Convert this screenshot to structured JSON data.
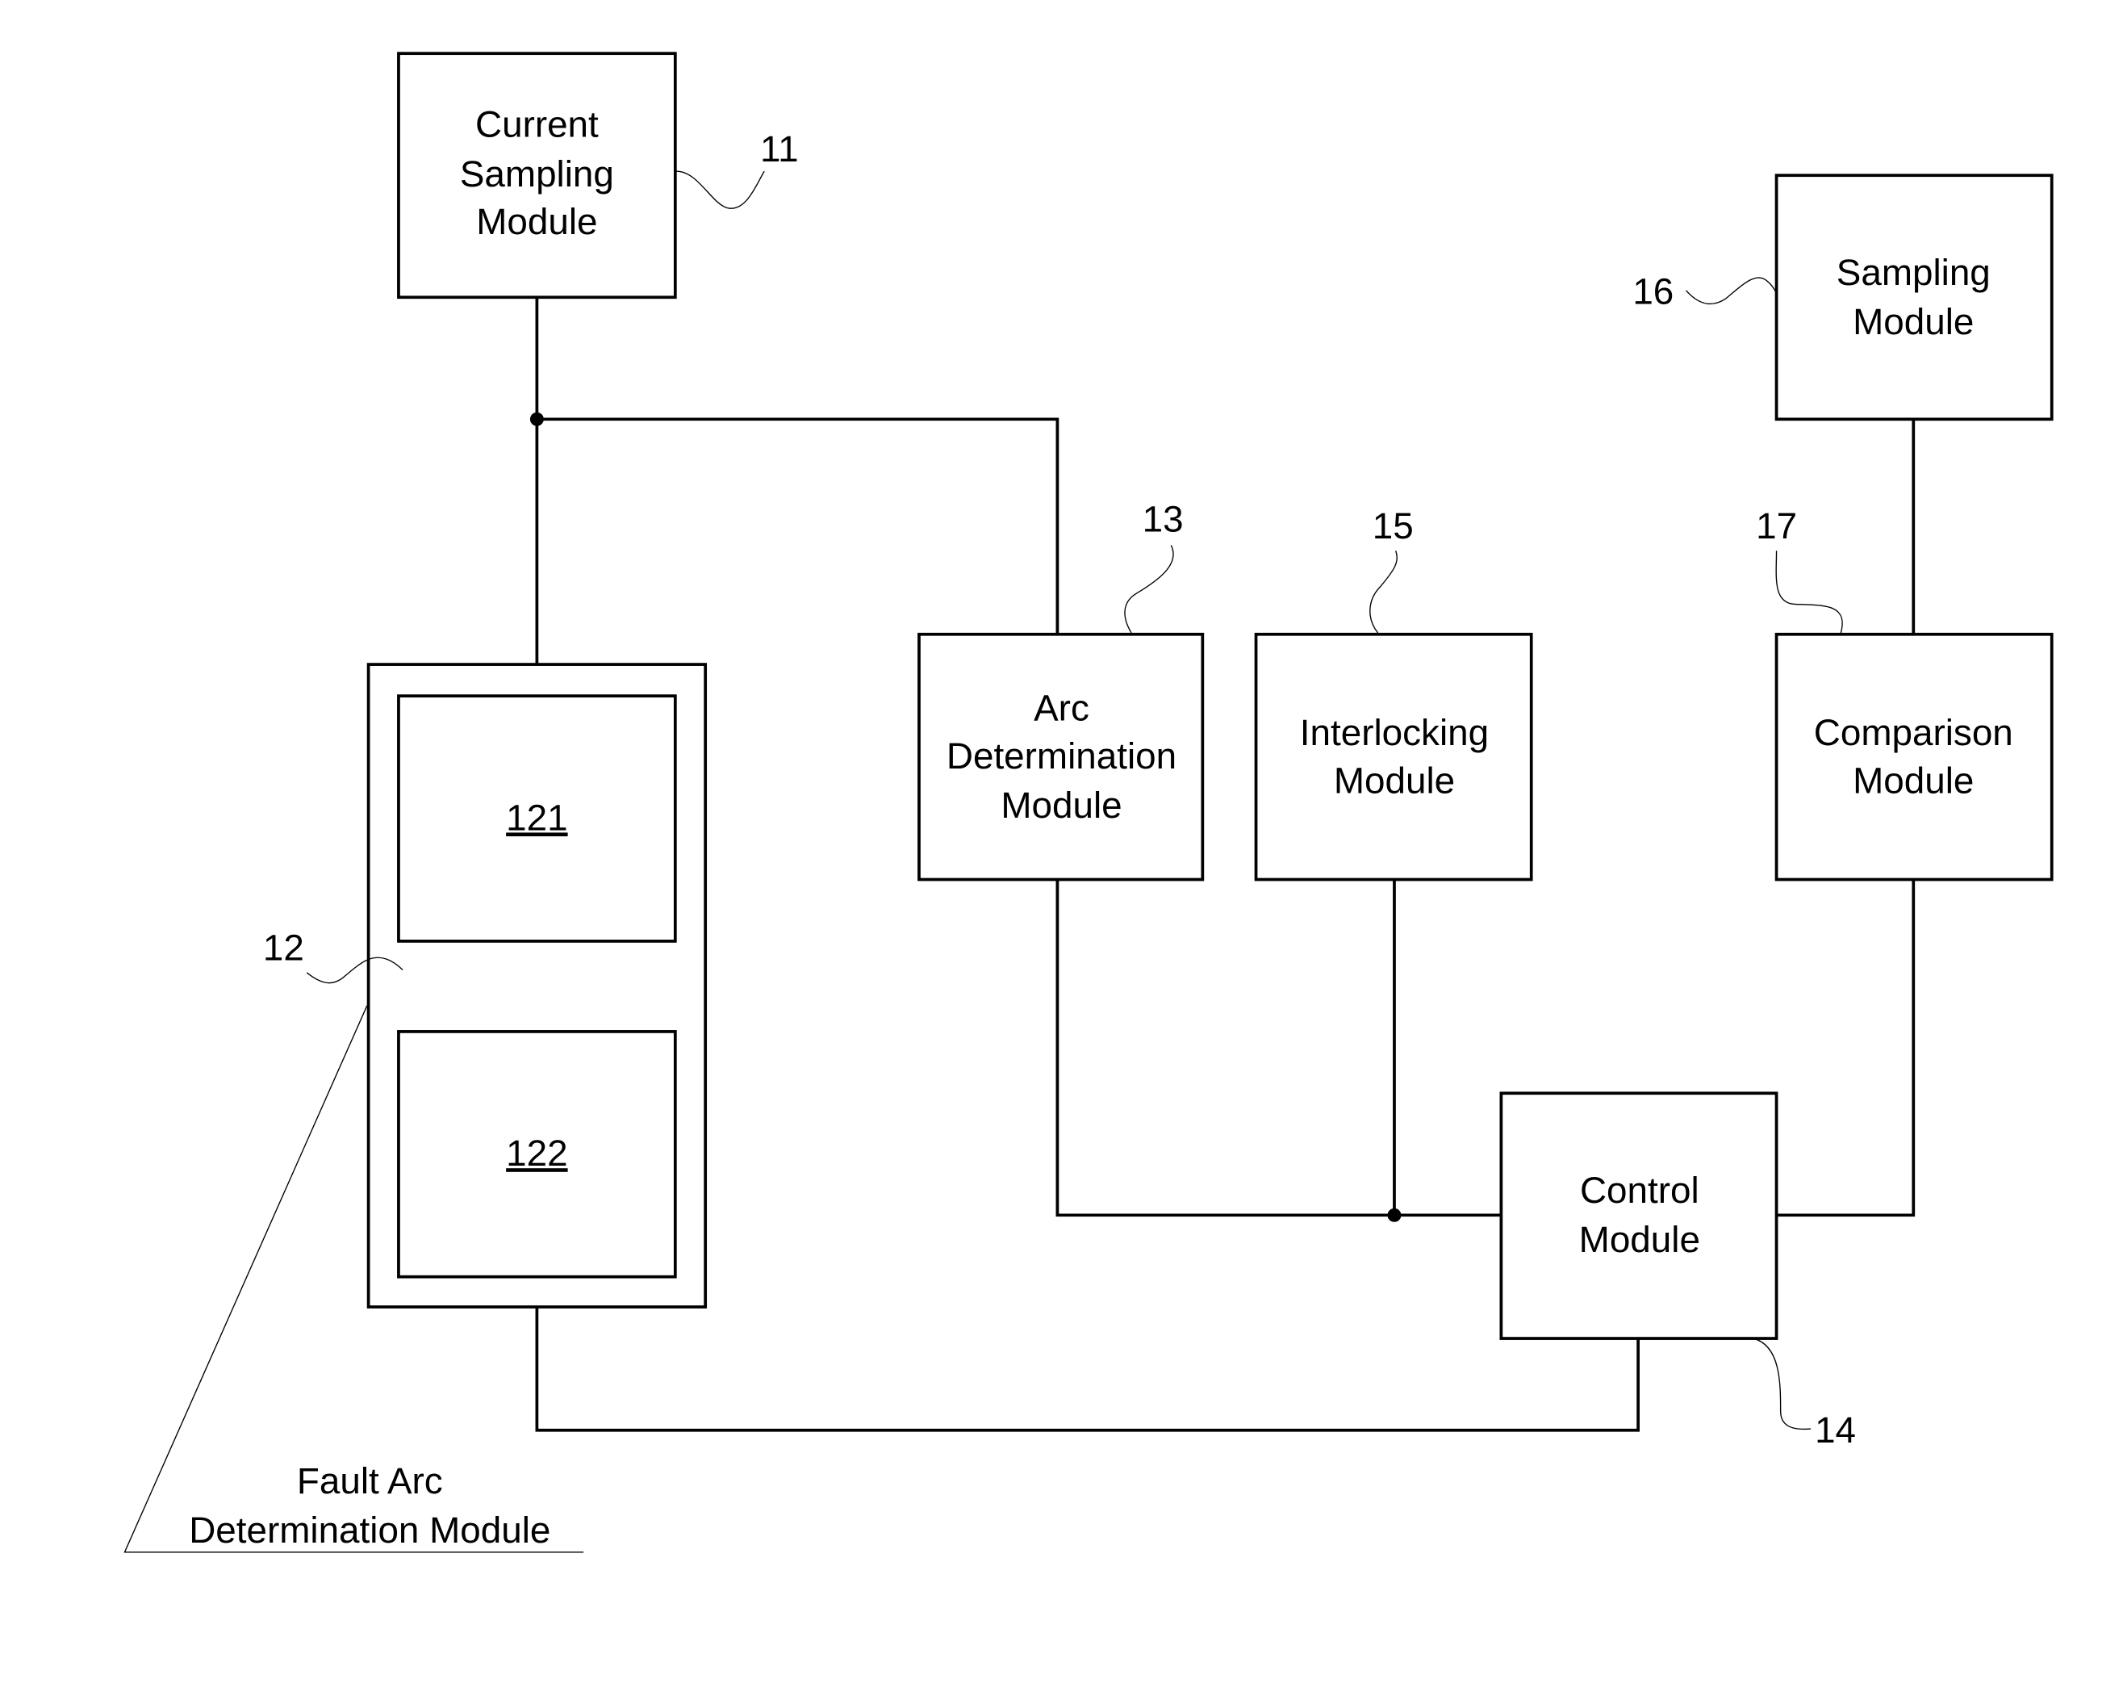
{
  "diagram": {
    "type": "block-diagram",
    "colors": {
      "line": "#000000",
      "background": "#ffffff"
    },
    "modules": {
      "current_sampling": {
        "ref": "11",
        "lines": [
          "Current",
          "Sampling",
          "Module"
        ]
      },
      "fault_arc": {
        "ref": "12",
        "callout": [
          "Fault Arc",
          "Determination Module"
        ],
        "submodules": [
          {
            "id": "121"
          },
          {
            "id": "122"
          }
        ]
      },
      "arc_determination": {
        "ref": "13",
        "lines": [
          "Arc",
          "Determination",
          "Module"
        ]
      },
      "control": {
        "ref": "14",
        "lines": [
          "Control",
          "Module"
        ]
      },
      "interlocking": {
        "ref": "15",
        "lines": [
          "Interlocking",
          "Module"
        ]
      },
      "sampling": {
        "ref": "16",
        "lines": [
          "Sampling",
          "Module"
        ]
      },
      "comparison": {
        "ref": "17",
        "lines": [
          "Comparison",
          "Module"
        ]
      }
    },
    "connections": [
      [
        "Current Sampling Module",
        "121"
      ],
      [
        "Current Sampling Module",
        "Arc Determination Module"
      ],
      [
        "121",
        "122"
      ],
      [
        "122",
        "Control Module"
      ],
      [
        "Arc Determination Module",
        "Control Module"
      ],
      [
        "Interlocking Module",
        "Control Module"
      ],
      [
        "Sampling Module",
        "Comparison Module"
      ],
      [
        "Comparison Module",
        "Control Module"
      ]
    ]
  }
}
